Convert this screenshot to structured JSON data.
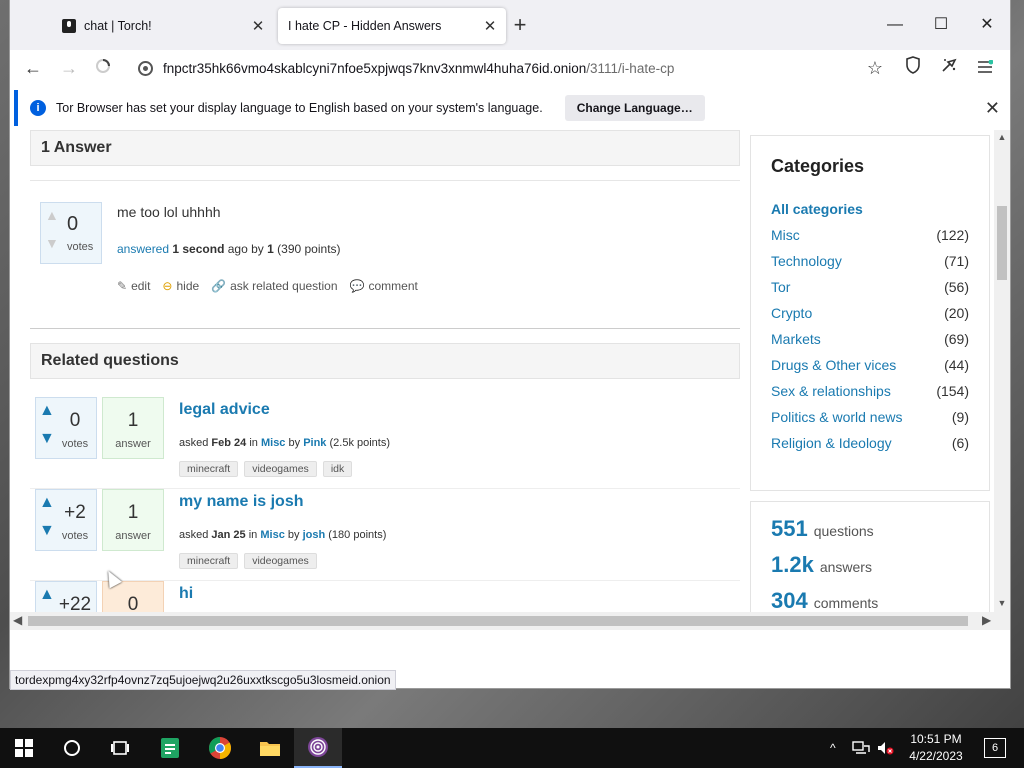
{
  "browser": {
    "tabs": [
      {
        "label": "chat | Torch!",
        "active": false
      },
      {
        "label": "I hate CP - Hidden Answers",
        "active": true
      }
    ],
    "url_host": "fnpctr35hk66vmo4skablcyni7nfoe5xpjwqs7knv3xnmwl4huha76id.onion",
    "url_path": "/3111/i-hate-cp",
    "notification": {
      "text": "Tor Browser has set your display language to English based on your system's language.",
      "button": "Change Language…"
    },
    "status_url": "tordexpmg4xy32rfp4ovnz7zq5ujoejwq2u26uxxtkscgo5u3losmeid.onion"
  },
  "answers_section": {
    "heading": "1 Answer",
    "answer": {
      "votes": "0",
      "votes_label": "votes",
      "text": "me too lol uhhhh",
      "meta_answered": "answered",
      "meta_time": "1 second",
      "meta_ago_by": "ago by",
      "meta_user": "1",
      "meta_points": "(390 points)",
      "actions": [
        "edit",
        "hide",
        "ask related question",
        "comment"
      ]
    }
  },
  "related": {
    "heading": "Related questions",
    "questions": [
      {
        "votes": "0",
        "votes_label": "votes",
        "answers": "1",
        "answers_label": "answer",
        "title": "legal advice",
        "asked": "asked",
        "date": "Feb 24",
        "in": "in",
        "category": "Misc",
        "by": "by",
        "user": "Pink",
        "points": "(2.5k points)",
        "tags": [
          "minecraft",
          "videogames",
          "idk"
        ]
      },
      {
        "votes": "+2",
        "votes_label": "votes",
        "answers": "1",
        "answers_label": "answer",
        "title": "my name is josh",
        "asked": "asked",
        "date": "Jan 25",
        "in": "in",
        "category": "Misc",
        "by": "by",
        "user": "josh",
        "points": "(180 points)",
        "tags": [
          "minecraft",
          "videogames"
        ]
      },
      {
        "votes": "+22",
        "votes_label": "",
        "answers": "0",
        "answers_label": "",
        "title": "hi",
        "asked": "",
        "date": "",
        "in": "",
        "category": "",
        "by": "",
        "user": "",
        "points": "",
        "tags": []
      }
    ]
  },
  "sidebar": {
    "heading": "Categories",
    "categories": [
      {
        "label": "All categories",
        "count": ""
      },
      {
        "label": "Misc",
        "count": "(122)"
      },
      {
        "label": "Technology",
        "count": "(71)"
      },
      {
        "label": "Tor",
        "count": "(56)"
      },
      {
        "label": "Crypto",
        "count": "(20)"
      },
      {
        "label": "Markets",
        "count": "(69)"
      },
      {
        "label": "Drugs & Other vices",
        "count": "(44)"
      },
      {
        "label": "Sex & relationships",
        "count": "(154)"
      },
      {
        "label": "Politics & world news",
        "count": "(9)"
      },
      {
        "label": "Religion & Ideology",
        "count": "(6)"
      }
    ],
    "stats": [
      {
        "value": "551",
        "label": "questions"
      },
      {
        "value": "1.2k",
        "label": "answers"
      },
      {
        "value": "304",
        "label": "comments"
      }
    ]
  },
  "taskbar": {
    "time": "10:51 PM",
    "date": "4/22/2023",
    "notifications": "6",
    "icons": [
      "windows-start-icon",
      "search-circle-icon",
      "task-view-icon",
      "sheets-app-icon",
      "chrome-icon",
      "file-explorer-icon",
      "tor-browser-icon"
    ]
  },
  "colors": {
    "link": "#1a7ab0",
    "accent": "#0060df"
  }
}
